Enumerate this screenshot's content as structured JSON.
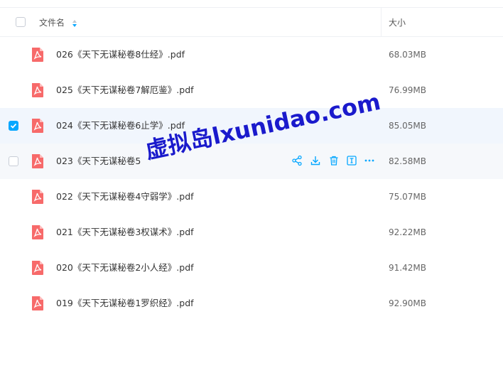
{
  "header": {
    "name_label": "文件名",
    "size_label": "大小"
  },
  "files": [
    {
      "name": "026《天下无谋秘卷8仕经》.pdf",
      "size": "68.03MB",
      "checked": false
    },
    {
      "name": "025《天下无谋秘卷7解厄鉴》.pdf",
      "size": "76.99MB",
      "checked": false
    },
    {
      "name": "024《天下无谋秘卷6止学》.pdf",
      "size": "85.05MB",
      "checked": true
    },
    {
      "name": "023《天下无谋秘卷5",
      "size": "82.58MB",
      "checked": false
    },
    {
      "name": "022《天下无谋秘卷4守弱学》.pdf",
      "size": "75.07MB",
      "checked": false
    },
    {
      "name": "021《天下无谋秘卷3权谋术》.pdf",
      "size": "92.22MB",
      "checked": false
    },
    {
      "name": "020《天下无谋秘卷2小人经》.pdf",
      "size": "91.42MB",
      "checked": false
    },
    {
      "name": "019《天下无谋秘卷1罗织经》.pdf",
      "size": "92.90MB",
      "checked": false
    }
  ],
  "row_actions": [
    "share-icon",
    "download-icon",
    "delete-icon",
    "rename-icon",
    "more-icon"
  ],
  "watermark": "虚拟岛lxunidao.com",
  "colors": {
    "accent": "#06a7ff",
    "pdf_red": "#f76a6a",
    "watermark": "#1a1acc"
  }
}
